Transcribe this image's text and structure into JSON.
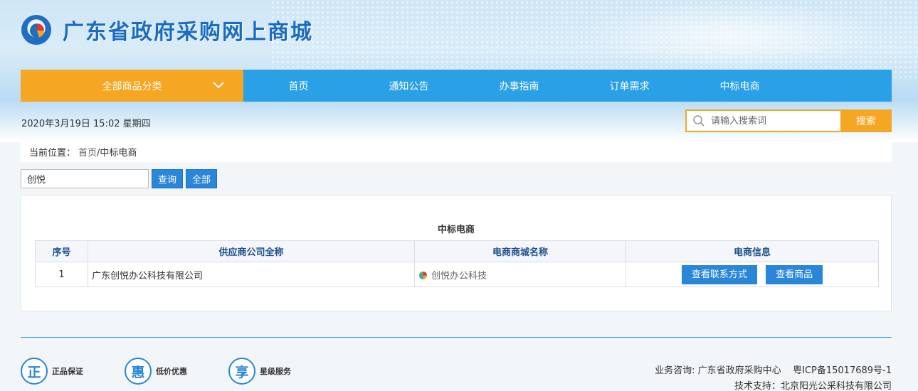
{
  "site": {
    "title": "广东省政府采购网上商城"
  },
  "nav": {
    "category_label": "全部商品分类",
    "items": [
      "首页",
      "通知公告",
      "办事指南",
      "订单需求",
      "中标电商"
    ]
  },
  "datetime": "2020年3月19日 15:02 星期四",
  "search": {
    "placeholder": "请输入搜索词",
    "button": "搜索"
  },
  "breadcrumb": {
    "prefix": "当前位置：",
    "home": "首页",
    "current": "/中标电商"
  },
  "filter": {
    "value": "创悦",
    "query_button": "查询",
    "all_button": "全部"
  },
  "panel": {
    "title": "中标电商",
    "headers": [
      "序号",
      "供应商公司全称",
      "电商商城名称",
      "电商信息"
    ],
    "rows": [
      {
        "index": "1",
        "company": "广东创悦办公科技有限公司",
        "mall": "创悦办公科技",
        "contact_button": "查看联系方式",
        "goods_button": "查看商品"
      }
    ]
  },
  "footer": {
    "badges": [
      {
        "glyph": "正",
        "label": "正品保证"
      },
      {
        "glyph": "惠",
        "label": "低价优惠"
      },
      {
        "glyph": "享",
        "label": "星级服务"
      }
    ],
    "consult": "业务咨询: 广东省政府采购中心",
    "icp": "粤ICP备15017689号-1",
    "support": "技术支持：北京阳光公采科技有限公司"
  },
  "colors": {
    "nav_blue": "#2aa0e7",
    "accent_orange": "#f5a623",
    "button_blue": "#2a86d8"
  }
}
